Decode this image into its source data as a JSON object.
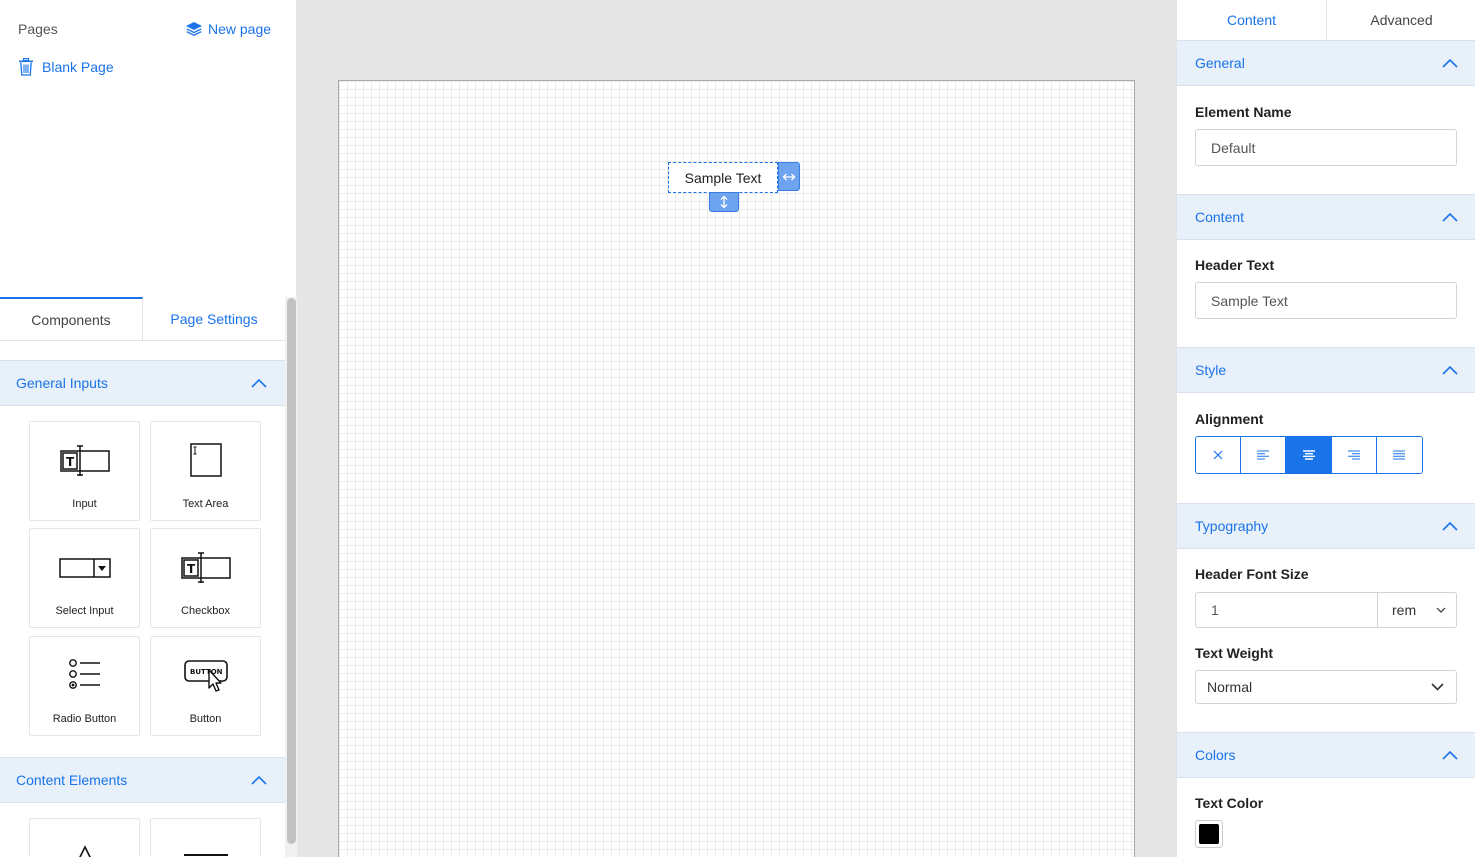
{
  "left_panel": {
    "pages_header": "Pages",
    "new_page_label": "New page",
    "pages": [
      {
        "label": "Blank Page"
      }
    ],
    "tabs": [
      {
        "label": "Components"
      },
      {
        "label": "Page Settings"
      }
    ],
    "sections": [
      {
        "title": "General Inputs",
        "components": [
          {
            "label": "Input",
            "icon": "text-input-icon"
          },
          {
            "label": "Text Area",
            "icon": "text-area-icon"
          },
          {
            "label": "Select Input",
            "icon": "select-input-icon"
          },
          {
            "label": "Checkbox",
            "icon": "checkbox-icon"
          },
          {
            "label": "Radio Button",
            "icon": "radio-button-icon"
          },
          {
            "label": "Button",
            "icon": "button-icon",
            "glyph_text": "BUTTON"
          }
        ]
      },
      {
        "title": "Content Elements"
      }
    ]
  },
  "canvas": {
    "element": {
      "text": "Sample Text"
    }
  },
  "right_panel": {
    "tabs": [
      {
        "label": "Content"
      },
      {
        "label": "Advanced"
      }
    ],
    "general": {
      "title": "General",
      "element_name_label": "Element Name",
      "element_name_value": "Default"
    },
    "content": {
      "title": "Content",
      "header_text_label": "Header Text",
      "header_text_value": "Sample Text"
    },
    "style": {
      "title": "Style",
      "alignment_label": "Alignment",
      "alignment_options": [
        "none",
        "left",
        "center",
        "right",
        "justify"
      ],
      "alignment_selected": "center"
    },
    "typography": {
      "title": "Typography",
      "font_size_label": "Header Font Size",
      "font_size_value": "1",
      "font_size_unit": "rem",
      "text_weight_label": "Text Weight",
      "text_weight_value": "Normal"
    },
    "colors": {
      "title": "Colors",
      "text_color_label": "Text Color",
      "text_color_value": "#000000"
    }
  },
  "colors": {
    "accent": "#1a73e8",
    "section_bg": "#e8f0fa",
    "handle": "#6ea3f0"
  }
}
